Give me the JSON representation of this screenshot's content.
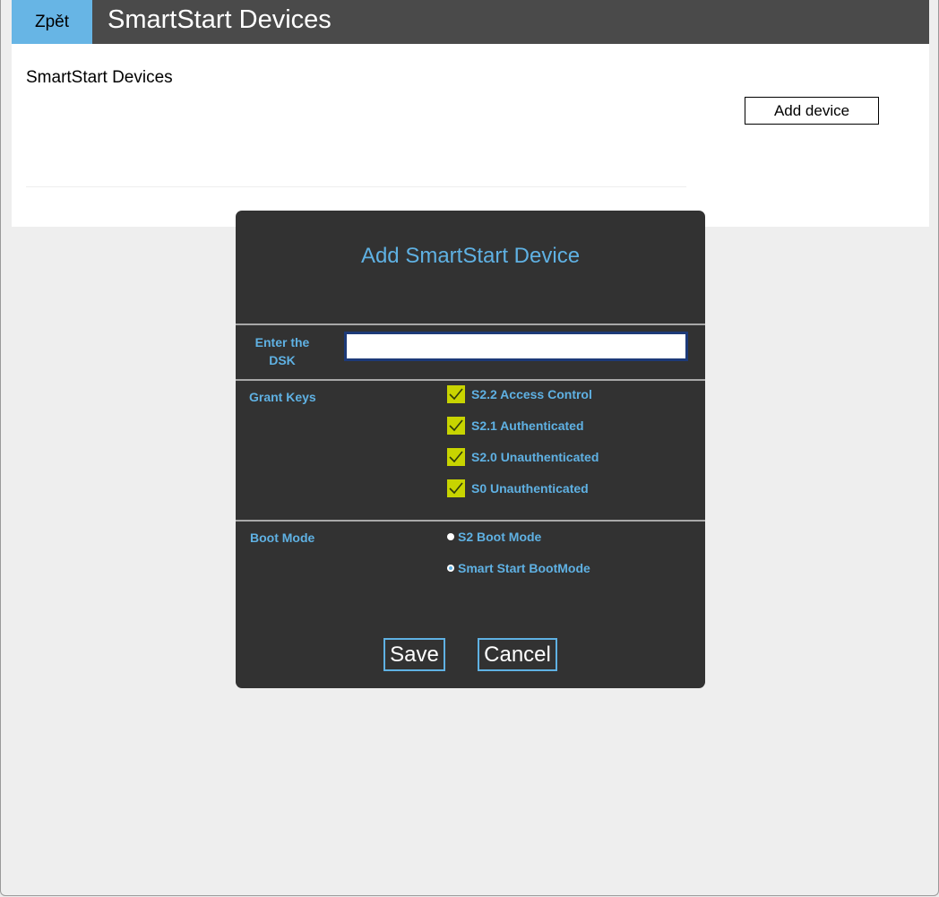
{
  "header": {
    "back_label": "Zpět",
    "title": "SmartStart Devices"
  },
  "content": {
    "title": "SmartStart Devices",
    "add_device_label": "Add device"
  },
  "modal": {
    "title": "Add SmartStart Device",
    "dsk": {
      "label_line1": "Enter the",
      "label_line2": "DSK",
      "value": "",
      "placeholder": ""
    },
    "grant_keys": {
      "label": "Grant Keys",
      "items": [
        {
          "label": "S2.2 Access Control",
          "checked": true
        },
        {
          "label": "S2.1 Authenticated",
          "checked": true
        },
        {
          "label": "S2.0 Unauthenticated",
          "checked": true
        },
        {
          "label": "S0 Unauthenticated",
          "checked": true
        }
      ]
    },
    "boot_mode": {
      "label": "Boot Mode",
      "options": [
        {
          "label": "S2 Boot Mode",
          "selected": false
        },
        {
          "label": "Smart Start BootMode",
          "selected": true
        }
      ]
    },
    "save_label": "Save",
    "cancel_label": "Cancel"
  },
  "colors": {
    "accent": "#5fb1e3",
    "back_button": "#67b5e5",
    "header_bg": "#4a4a4a",
    "modal_bg": "#323232",
    "checkbox_fill": "#c8d400"
  },
  "icons": {
    "checkbox": "check-icon",
    "radio": "radio-icon"
  }
}
